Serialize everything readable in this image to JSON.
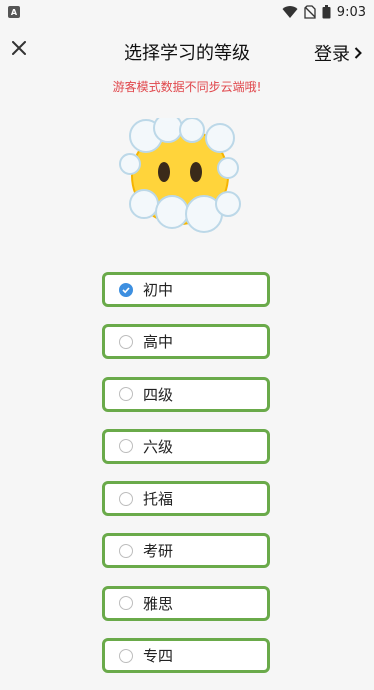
{
  "status_bar": {
    "app_badge": "A",
    "time": "9:03",
    "icons": [
      "wifi-icon",
      "no-sim-icon",
      "battery-icon"
    ]
  },
  "header": {
    "close_icon": "close-icon",
    "title": "选择学习的等级",
    "login_label": "登录",
    "login_icon": "chevron-right-icon"
  },
  "guest_notice": "游客模式数据不同步云端哦!",
  "mascot_icon": "face-in-clouds-emoji",
  "colors": {
    "notice": "#e0464b",
    "option_border": "#6aaa4a",
    "radio_checked": "#3d8fe0"
  },
  "levels": [
    {
      "label": "初中",
      "selected": true
    },
    {
      "label": "高中",
      "selected": false
    },
    {
      "label": "四级",
      "selected": false
    },
    {
      "label": "六级",
      "selected": false
    },
    {
      "label": "托福",
      "selected": false
    },
    {
      "label": "考研",
      "selected": false
    },
    {
      "label": "雅思",
      "selected": false
    },
    {
      "label": "专四",
      "selected": false
    }
  ]
}
